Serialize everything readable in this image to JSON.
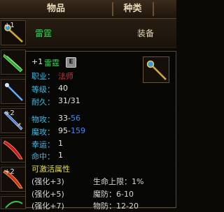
{
  "header": {
    "col_item": "物品",
    "col_type": "种类"
  },
  "inventory": [
    {
      "plus": "+1",
      "name": "雷霆",
      "type": "装备",
      "icon": "golden-staff-icon",
      "selected": true
    },
    {
      "plus": "",
      "name": "",
      "type": "",
      "icon": "green-blade-icon"
    },
    {
      "plus": "",
      "name": "",
      "type": "",
      "icon": "blue-staff-icon"
    },
    {
      "plus": "+2",
      "name": "",
      "type": "",
      "icon": "blue-sword-icon"
    },
    {
      "plus": "",
      "name": "",
      "type": "",
      "icon": "red-saber-icon"
    },
    {
      "plus": "+2",
      "name": "",
      "type": "",
      "icon": "red-saber-icon"
    },
    {
      "plus": "",
      "name": "",
      "type": "",
      "icon": "green-bow-icon"
    }
  ],
  "tooltip": {
    "plus": "+1",
    "name": "雷霆",
    "badge": "E",
    "icon": "golden-staff-icon",
    "job_label": "职业：",
    "job_value": "法师",
    "level_label": "等级：",
    "level_value": "40",
    "durability_label": "耐久：",
    "durability_value": "31/31",
    "phys_attack_label": "物攻：",
    "phys_attack_min": "33",
    "phys_attack_dash": "-",
    "phys_attack_max": "56",
    "mag_attack_label": "魔攻：",
    "mag_attack_min": "95",
    "mag_attack_dash": "-",
    "mag_attack_max": "159",
    "luck_label": "幸运：",
    "luck_value": "1",
    "accuracy_label": "命中：",
    "accuracy_value": "1",
    "activatable_label": "可激活属性",
    "bonuses": [
      {
        "tier": "(强化+3)",
        "stat": "生命上限：1%"
      },
      {
        "tier": "(强化+5)",
        "stat": "魔防：6-10"
      },
      {
        "tier": "(强化+7)",
        "stat": "物防：12-20"
      }
    ]
  },
  "colors": {
    "label_cyan": "#3bbfe8",
    "name_green": "#22e050",
    "job_red": "#e02c2c",
    "max_blue": "#3a8bff",
    "header_gold": "#e8d9b8"
  }
}
